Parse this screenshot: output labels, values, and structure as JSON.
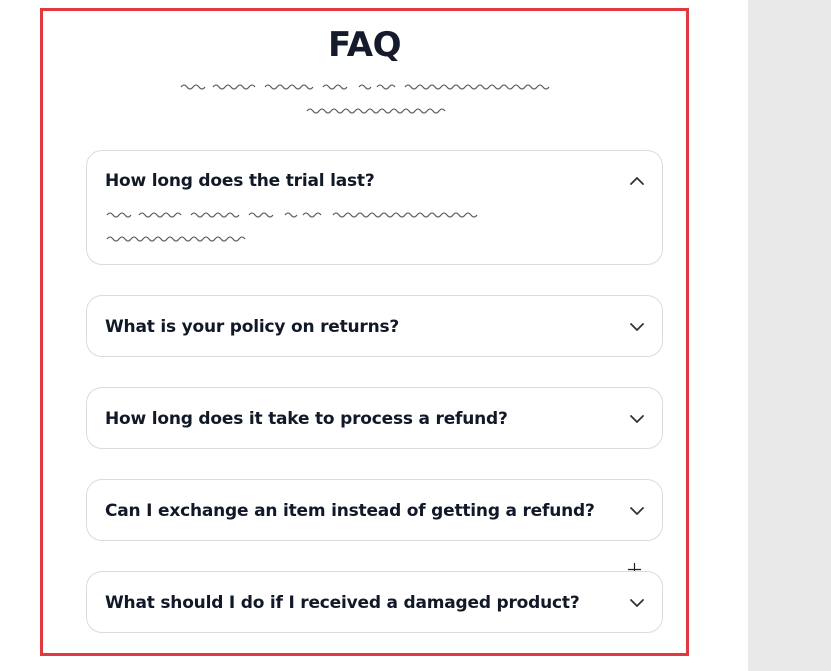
{
  "faq": {
    "title": "FAQ",
    "items": [
      {
        "question": "How long does the trial last?",
        "expanded": true
      },
      {
        "question": "What is your policy on returns?",
        "expanded": false
      },
      {
        "question": "How long does it take to process a refund?",
        "expanded": false
      },
      {
        "question": "Can I exchange an item instead of getting a refund?",
        "expanded": false
      },
      {
        "question": "What should I do if I received a damaged product?",
        "expanded": false
      }
    ]
  },
  "icons": {
    "expanded": "chevron-up-icon",
    "collapsed": "chevron-down-icon",
    "cursor": "crosshair-cursor-icon"
  },
  "colors": {
    "frame_border": "#e0393f",
    "title": "#151b2a",
    "card_border": "#d9dce0",
    "right_panel": "#e9e9ea"
  }
}
